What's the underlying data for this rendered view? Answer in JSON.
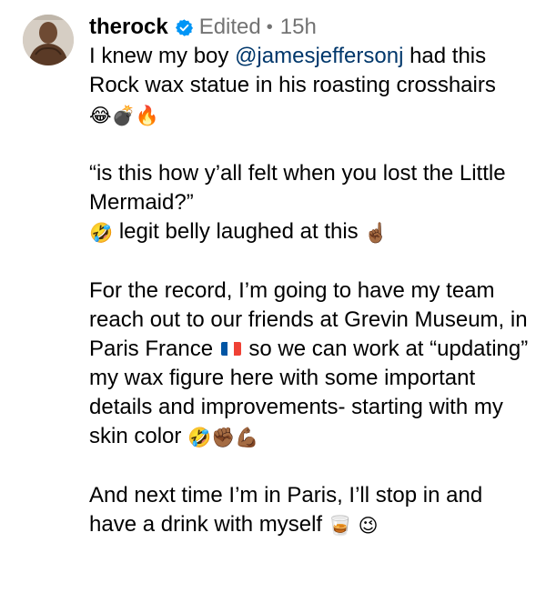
{
  "post": {
    "username": "therock",
    "edited_label": "Edited",
    "separator": "•",
    "time_ago": "15h",
    "icons": {
      "verified": "verified-badge-icon",
      "verified_color": "#0095f6"
    },
    "caption": {
      "p1_before": "I knew my boy ",
      "p1_mention": "@jamesjeffersonj",
      "p1_after": " had this Rock wax statue in his roasting crosshairs ",
      "p1_emoji": "😂💣🔥",
      "p2_line1": "“is this how y’all felt when you lost the Little Mermaid?”",
      "p2_emoji": "🤣",
      "p2_line2": " legit belly laughed at this ",
      "p2_emoji2": "☝🏾",
      "p3_text_a": "For the record, I’m going to have my team reach out to our friends at Grevin Museum, in Paris France ",
      "p3_flag": "🇫🇷",
      "p3_text_b": " so we can work at “updating” my wax figure here with some important details and improvements- starting with my skin color ",
      "p3_emoji": "🤣✊🏾💪🏾",
      "p4_text": "And next time I’m in Paris, I’ll stop in and have a drink with myself ",
      "p4_emoji": "🥃 😉"
    }
  }
}
